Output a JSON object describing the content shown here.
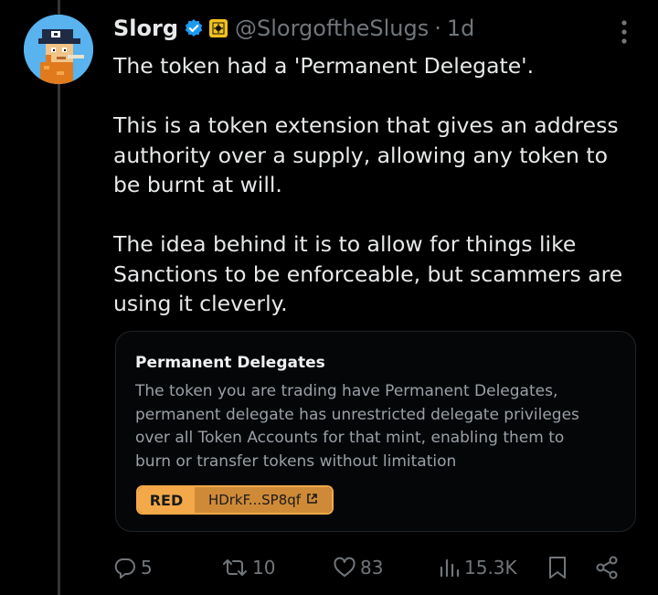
{
  "tweet": {
    "display_name": "Slorg",
    "handle": "@SlorgoftheSlugs",
    "separator": "·",
    "time": "1d",
    "paragraphs": [
      "The token had a 'Permanent Delegate'.",
      "This is a token extension that gives an address authority over a supply, allowing any token to be burnt at will.",
      "The idea behind it is to allow for things like Sanctions to be enforceable, but scammers are using it cleverly."
    ]
  },
  "card": {
    "title": "Permanent Delegates",
    "description": "The token you are trading have Permanent Delegates, permanent delegate has unrestricted delegate privileges over all Token Accounts for that mint, enabling them to burn or transfer tokens without limitation",
    "risk_level": "RED",
    "address": "HDrkF...SP8qf"
  },
  "actions": {
    "replies": "5",
    "reposts": "10",
    "likes": "83",
    "views": "15.3K"
  },
  "colors": {
    "background": "#000000",
    "text": "#e7e9ea",
    "muted": "#71767b",
    "verified": "#1d9bf0",
    "tag_red_level": "#f3a94a",
    "tag_address": "#cf8a37"
  },
  "icons": {
    "verified": "verified-badge-icon",
    "affiliate": "affiliate-badge-icon",
    "more": "more-vertical-icon",
    "reply": "reply-icon",
    "repost": "repost-icon",
    "like": "heart-icon",
    "views": "views-chart-icon",
    "bookmark": "bookmark-icon",
    "share": "share-icon",
    "external": "external-link-icon"
  }
}
